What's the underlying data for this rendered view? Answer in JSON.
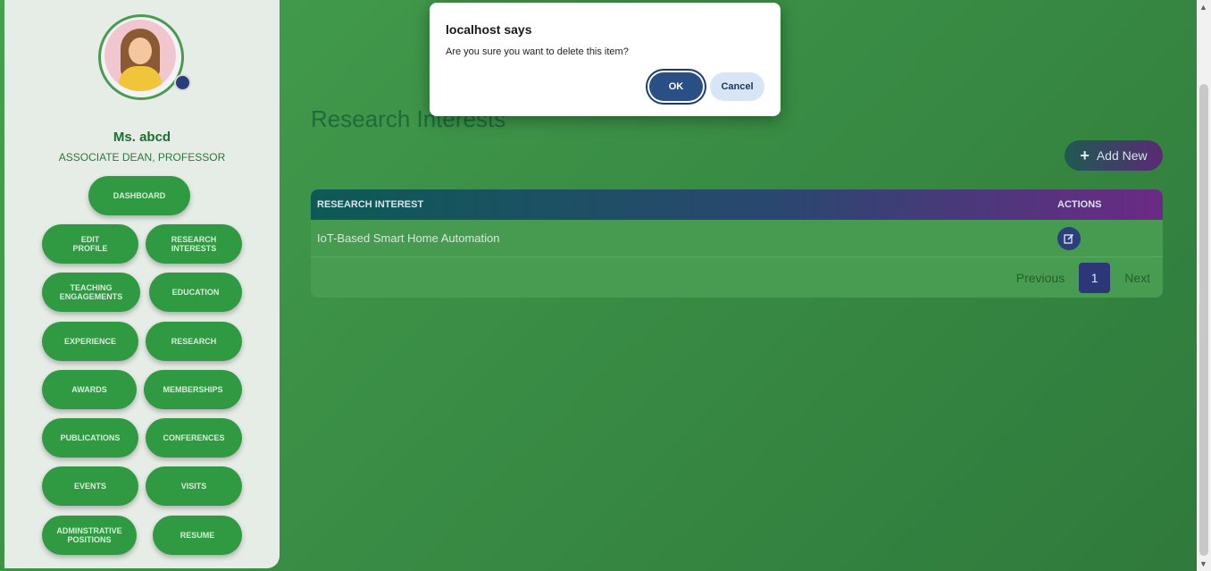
{
  "profile": {
    "name": "Ms. abcd",
    "role": "ASSOCIATE DEAN, PROFESSOR"
  },
  "sidebar": {
    "items": [
      {
        "label": "DASHBOARD"
      },
      {
        "label": "EDIT PROFILE"
      },
      {
        "label": "RESEARCH INTERESTS"
      },
      {
        "label": "TEACHING ENGAGEMENTS"
      },
      {
        "label": "EDUCATION"
      },
      {
        "label": "EXPERIENCE"
      },
      {
        "label": "RESEARCH"
      },
      {
        "label": "AWARDS"
      },
      {
        "label": "MEMBERSHIPS"
      },
      {
        "label": "PUBLICATIONS"
      },
      {
        "label": "CONFERENCES"
      },
      {
        "label": "EVENTS"
      },
      {
        "label": "VISITS"
      },
      {
        "label": "ADMINSTRATIVE POSITIONS"
      },
      {
        "label": "RESUME"
      }
    ]
  },
  "page": {
    "title": "Research Interests",
    "add_label": "Add New"
  },
  "table": {
    "columns": [
      "RESEARCH INTEREST",
      "ACTIONS"
    ],
    "rows": [
      {
        "interest": "IoT-Based Smart Home Automation"
      }
    ]
  },
  "pagination": {
    "previous": "Previous",
    "current": "1",
    "next": "Next"
  },
  "dialog": {
    "title": "localhost says",
    "message": "Are you sure you want to delete this item?",
    "ok_label": "OK",
    "cancel_label": "Cancel"
  },
  "colors": {
    "brand_green": "#2f9a42",
    "dialog_primary": "#2a4f85",
    "pager_active": "#2b3777"
  }
}
